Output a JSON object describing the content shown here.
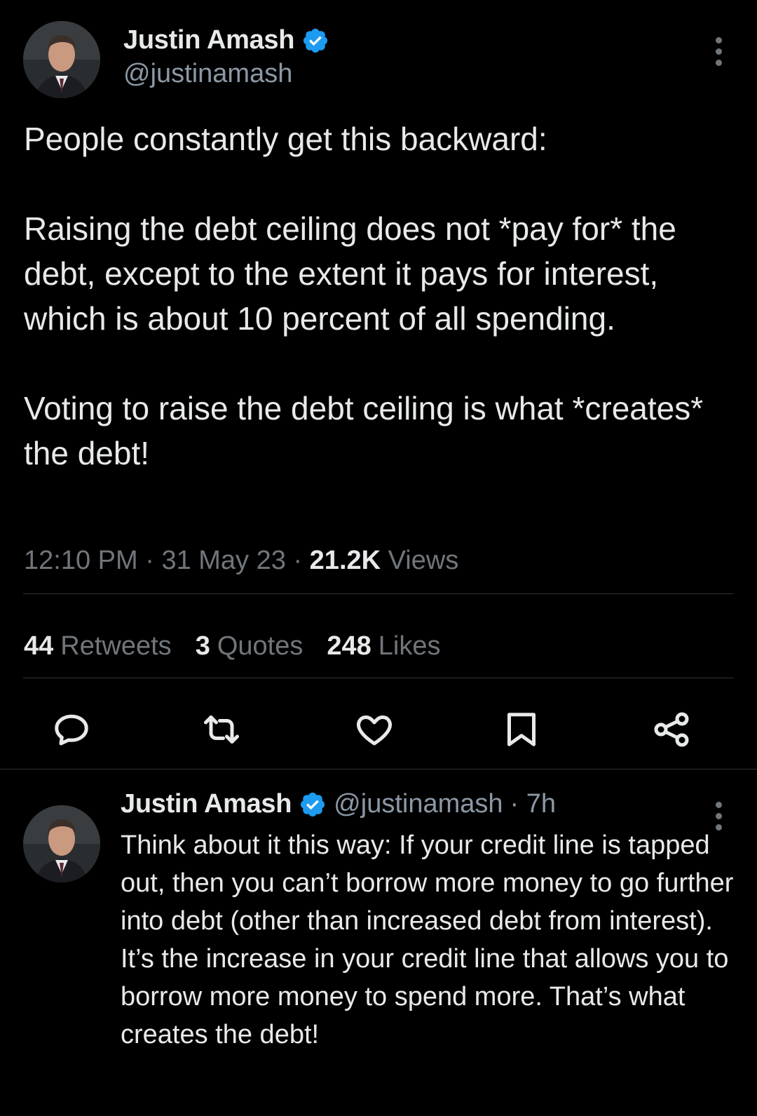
{
  "main_tweet": {
    "author": {
      "display_name": "Justin Amash",
      "handle": "@justinamash",
      "verified": true,
      "avatar_icon": "avatar-photo"
    },
    "text": "People constantly get this backward:\n\nRaising the debt ceiling does not *pay for* the debt, except to the extent it pays for interest, which is about 10 percent of all spending.\n\nVoting to raise the debt ceiling is what *creates* the debt!",
    "time": "12:10 PM",
    "date": "31 May 23",
    "separator": "·",
    "views_count": "21.2K",
    "views_label": "Views",
    "stats": {
      "retweets_count": "44",
      "retweets_label": "Retweets",
      "quotes_count": "3",
      "quotes_label": "Quotes",
      "likes_count": "248",
      "likes_label": "Likes"
    },
    "actions": [
      "reply-icon",
      "retweet-icon",
      "like-icon",
      "bookmark-icon",
      "share-icon"
    ]
  },
  "reply_tweet": {
    "author": {
      "display_name": "Justin Amash",
      "handle": "@justinamash",
      "verified": true
    },
    "age": "· 7h",
    "text": "Think about it this way: If your credit line is tapped out, then you can’t borrow more money to go further into debt (other than increased debt from interest). It’s the increase in your credit line that allows you to borrow more money to spend more. That’s what creates the debt!"
  },
  "colors": {
    "background": "#000000",
    "primary_text": "#e7e9ea",
    "secondary_text": "#71767b",
    "verified_blue": "#1d9bf0",
    "divider": "#2f3336"
  }
}
